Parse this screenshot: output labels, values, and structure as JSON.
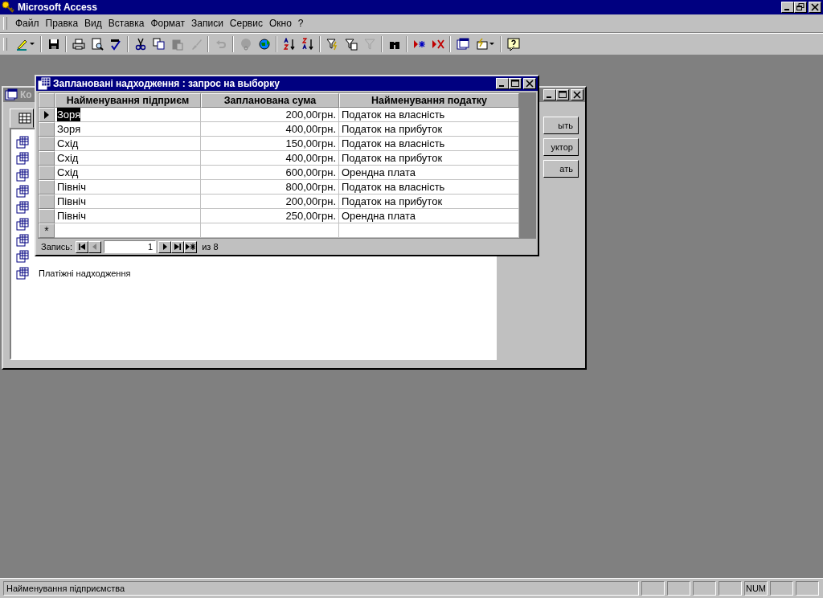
{
  "app": {
    "title": "Microsoft Access"
  },
  "menu": [
    "Файл",
    "Правка",
    "Вид",
    "Вставка",
    "Формат",
    "Записи",
    "Сервис",
    "Окно",
    "?"
  ],
  "back_window": {
    "title": "Ко",
    "buttons": [
      "ыть",
      "уктор",
      "ать"
    ],
    "objects": [
      "Платіжні надходження"
    ]
  },
  "query_window": {
    "title": "Заплановані надходження : запрос на выборку",
    "columns": [
      "Найменування підприєм",
      "Запланована сума",
      "Найменування податку"
    ],
    "rows": [
      {
        "name": "Зоря",
        "sum": "200,00грн.",
        "tax": "Податок на власність",
        "current": true
      },
      {
        "name": "Зоря",
        "sum": "400,00грн.",
        "tax": "Податок на прибуток",
        "current": false
      },
      {
        "name": "Схід",
        "sum": "150,00грн.",
        "tax": "Податок на власність",
        "current": false
      },
      {
        "name": "Схід",
        "sum": "400,00грн.",
        "tax": "Податок на прибуток",
        "current": false
      },
      {
        "name": "Схід",
        "sum": "600,00грн.",
        "tax": "Орендна плата",
        "current": false
      },
      {
        "name": "Північ",
        "sum": "800,00грн.",
        "tax": "Податок на власність",
        "current": false
      },
      {
        "name": "Північ",
        "sum": "200,00грн.",
        "tax": "Податок на прибуток",
        "current": false
      },
      {
        "name": "Північ",
        "sum": "250,00грн.",
        "tax": "Орендна плата",
        "current": false
      }
    ],
    "new_row_marker": "*",
    "nav": {
      "label": "Запись:",
      "record": "1",
      "total": "из 8"
    }
  },
  "status_bar": {
    "text": "Найменування підприємства",
    "indicator": "NUM"
  }
}
